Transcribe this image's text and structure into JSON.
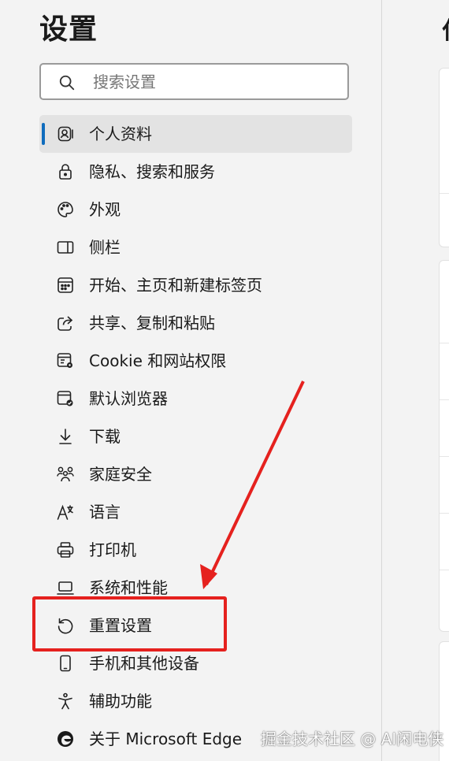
{
  "sidebar": {
    "title": "设置",
    "search": {
      "placeholder": "搜索设置",
      "icon": "search-icon"
    },
    "items": [
      {
        "label": "个人资料",
        "icon": "profile-icon",
        "active": true
      },
      {
        "label": "隐私、搜索和服务",
        "icon": "lock-icon"
      },
      {
        "label": "外观",
        "icon": "palette-icon"
      },
      {
        "label": "侧栏",
        "icon": "sidebar-icon"
      },
      {
        "label": "开始、主页和新建标签页",
        "icon": "home-grid-icon"
      },
      {
        "label": "共享、复制和粘贴",
        "icon": "share-icon"
      },
      {
        "label": "Cookie 和网站权限",
        "icon": "site-permissions-icon"
      },
      {
        "label": "默认浏览器",
        "icon": "default-browser-icon"
      },
      {
        "label": "下载",
        "icon": "download-icon"
      },
      {
        "label": "家庭安全",
        "icon": "family-icon"
      },
      {
        "label": "语言",
        "icon": "language-icon"
      },
      {
        "label": "打印机",
        "icon": "printer-icon"
      },
      {
        "label": "系统和性能",
        "icon": "laptop-icon"
      },
      {
        "label": "重置设置",
        "icon": "reset-icon"
      },
      {
        "label": "手机和其他设备",
        "icon": "phone-icon"
      },
      {
        "label": "辅助功能",
        "icon": "accessibility-icon"
      },
      {
        "label": "关于 Microsoft Edge",
        "icon": "edge-logo-icon"
      }
    ]
  },
  "main": {
    "title_partial": "仁"
  },
  "annotation": {
    "highlight_color": "#e5211e",
    "highlighted_item": "重置设置"
  },
  "watermark": "掘金技术社区 @ AI闲电侠",
  "colors": {
    "accent": "#0f6cbd",
    "background": "#f3f3f3",
    "active_item": "#e3e3e3"
  }
}
